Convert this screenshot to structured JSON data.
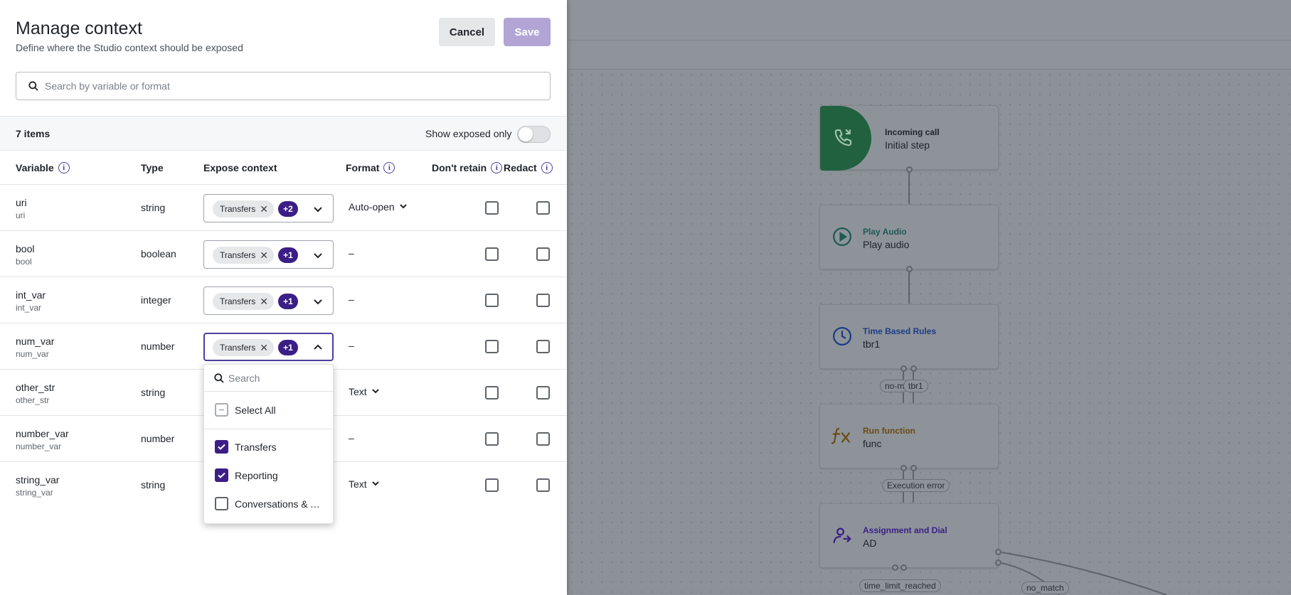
{
  "panel": {
    "title": "Manage context",
    "subtitle": "Define where the Studio context should be exposed",
    "cancel_label": "Cancel",
    "save_label": "Save",
    "search_placeholder": "Search by variable or format",
    "items_count": "7 items",
    "show_exposed_label": "Show exposed only",
    "show_exposed_on": false
  },
  "table": {
    "headers": {
      "variable": "Variable",
      "type": "Type",
      "expose": "Expose context",
      "format": "Format",
      "dont_retain": "Don't retain",
      "redact": "Redact"
    },
    "rows": [
      {
        "name": "uri",
        "sub": "uri",
        "type": "string",
        "chip": "Transfers",
        "badge": "+2",
        "format": "Auto-open",
        "format_dropdown": true
      },
      {
        "name": "bool",
        "sub": "bool",
        "type": "boolean",
        "chip": "Transfers",
        "badge": "+1",
        "format": "–",
        "format_dropdown": false
      },
      {
        "name": "int_var",
        "sub": "int_var",
        "type": "integer",
        "chip": "Transfers",
        "badge": "+1",
        "format": "–",
        "format_dropdown": false
      },
      {
        "name": "num_var",
        "sub": "num_var",
        "type": "number",
        "chip": "Transfers",
        "badge": "+1",
        "format": "–",
        "format_dropdown": false
      },
      {
        "name": "other_str",
        "sub": "other_str",
        "type": "string",
        "format": "Text",
        "format_dropdown": true
      },
      {
        "name": "number_var",
        "sub": "number_var",
        "type": "number",
        "format": "–",
        "format_dropdown": false
      },
      {
        "name": "string_var",
        "sub": "string_var",
        "type": "string",
        "format": "Text",
        "format_dropdown": true
      }
    ]
  },
  "popup": {
    "search_placeholder": "Search",
    "select_all": "Select All",
    "options": [
      {
        "label": "Transfers",
        "checked": true
      },
      {
        "label": "Reporting",
        "checked": true
      },
      {
        "label": "Conversations & A...",
        "checked": false
      }
    ]
  },
  "flow": {
    "nodes": [
      {
        "type": "Incoming call",
        "name": "Initial step",
        "type_color": "#1f2329",
        "icon": "phone-incoming-icon"
      },
      {
        "type": "Play Audio",
        "name": "Play audio",
        "type_color": "#1e5a55",
        "icon": "play-circle-icon"
      },
      {
        "type": "Time Based Rules",
        "name": "tbr1",
        "type_color": "#1b3d86",
        "icon": "clock-icon"
      },
      {
        "type": "Run function",
        "name": "func",
        "type_color": "#6b4a12",
        "icon": "function-icon"
      },
      {
        "type": "Assignment and Dial",
        "name": "AD",
        "type_color": "#3b1f86",
        "icon": "user-dial-icon"
      }
    ],
    "edge_labels": [
      "no-m",
      "tbr1",
      "Execution error",
      "time_limit_reached",
      "no_match"
    ]
  },
  "colors": {
    "accent": "#3b1f86",
    "save_disabled": "#b2a5d6",
    "incoming_green": "#21613f"
  }
}
